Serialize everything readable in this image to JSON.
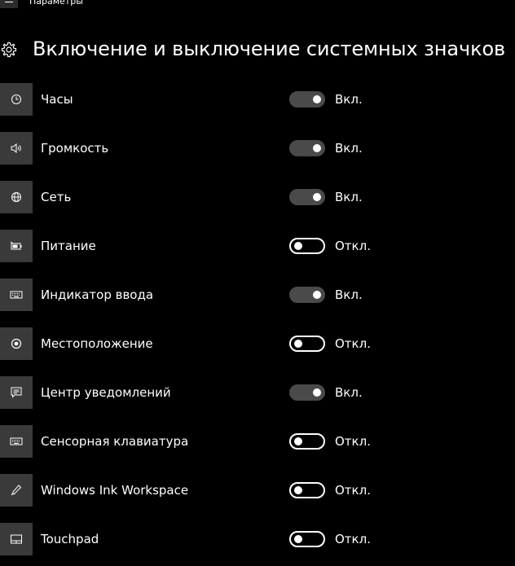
{
  "app": {
    "window_title": "Параметры"
  },
  "header": {
    "title": "Включение и выключение системных значков",
    "icon": "gear-icon"
  },
  "items": [
    {
      "label": "Часы",
      "state": "Вкл.",
      "on": true,
      "icon": "clock-icon"
    },
    {
      "label": "Громкость",
      "state": "Вкл.",
      "on": true,
      "icon": "volume-icon"
    },
    {
      "label": "Сеть",
      "state": "Вкл.",
      "on": true,
      "icon": "globe-icon"
    },
    {
      "label": "Питание",
      "state": "Откл.",
      "on": false,
      "icon": "battery-icon"
    },
    {
      "label": "Индикатор ввода",
      "state": "Вкл.",
      "on": true,
      "icon": "keyboard-icon"
    },
    {
      "label": "Местоположение",
      "state": "Откл.",
      "on": false,
      "icon": "location-icon"
    },
    {
      "label": "Центр уведомлений",
      "state": "Вкл.",
      "on": true,
      "icon": "notification-icon"
    },
    {
      "label": "Сенсорная клавиатура",
      "state": "Откл.",
      "on": false,
      "icon": "keyboard-icon"
    },
    {
      "label": "Windows Ink Workspace",
      "state": "Откл.",
      "on": false,
      "icon": "pen-icon"
    },
    {
      "label": "Touchpad",
      "state": "Откл.",
      "on": false,
      "icon": "touchpad-icon"
    }
  ],
  "colors": {
    "background": "#000000",
    "icon_tile": "#3a3a3a",
    "toggle_on": "#4a4a4a",
    "toggle_off_border": "#ffffff",
    "text": "#ffffff"
  }
}
